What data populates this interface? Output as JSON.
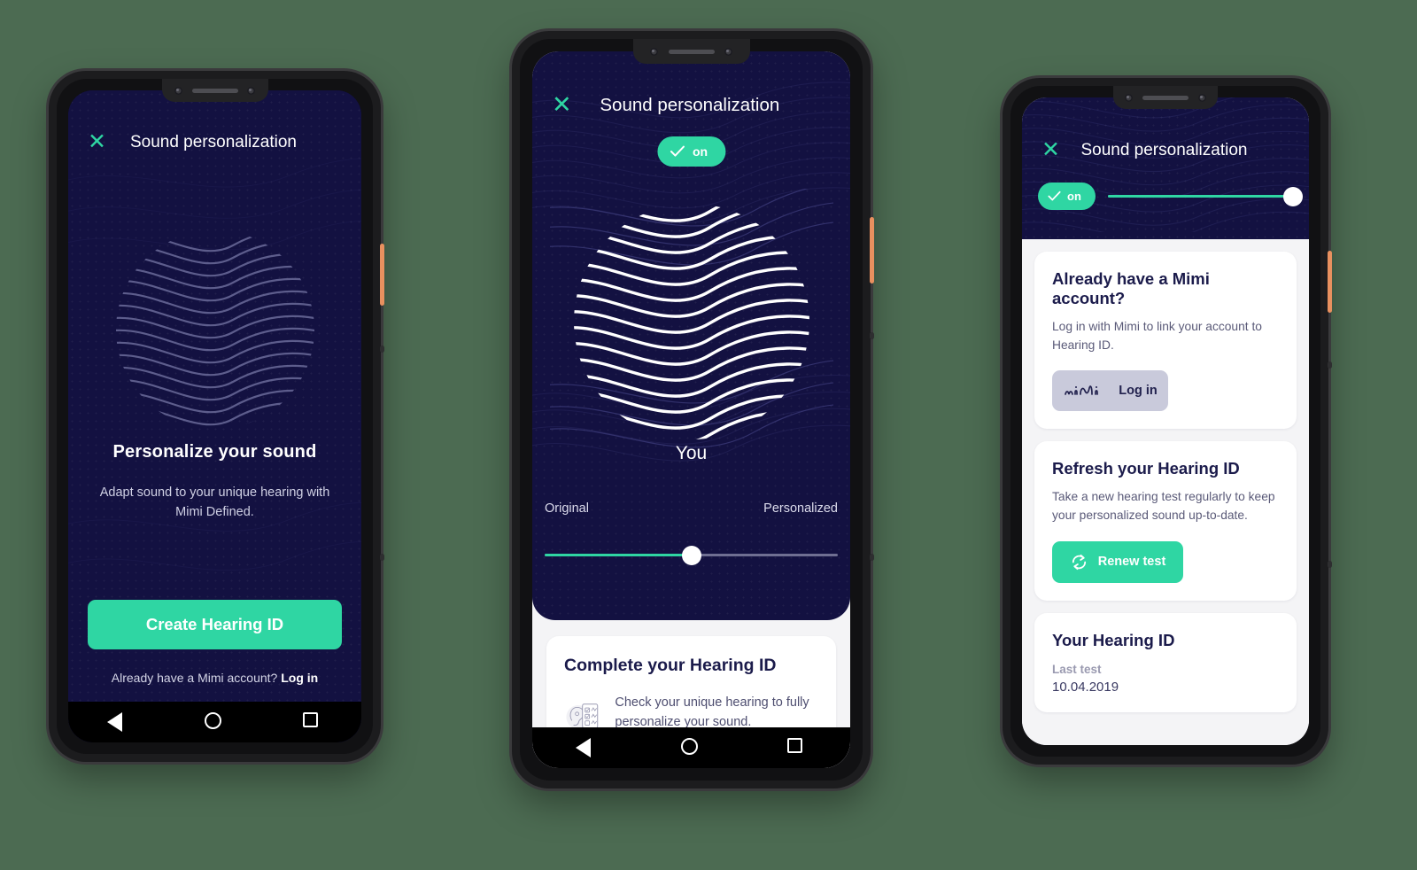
{
  "theme": {
    "page_background": "#4c6b52",
    "navy": "#131141",
    "accent_green": "#2fd6a3",
    "sheet_grey": "#f4f4f6",
    "card_white": "#ffffff",
    "login_button_grey": "#c9cadb",
    "heading_navy": "#1b1b4b"
  },
  "screens": [
    {
      "id": "onboarding",
      "topbar": {
        "close_icon": "close-icon",
        "title": "Sound personalization"
      },
      "hero_icon": "fingerprint-icon",
      "headline": "Personalize your sound",
      "subtext": "Adapt sound to your unique hearing with Mimi Defined.",
      "cta_label": "Create Hearing ID",
      "login_prompt": "Already have a Mimi account? ",
      "login_link": "Log in",
      "navbar": {
        "back_icon": "back-triangle-icon",
        "home_icon": "home-circle-icon",
        "recents_icon": "recents-square-icon"
      }
    },
    {
      "id": "personalization-active",
      "topbar": {
        "close_icon": "close-icon",
        "title": "Sound personalization"
      },
      "toggle": {
        "icon": "check-icon",
        "label": "on",
        "state": "on"
      },
      "hero_icon": "fingerprint-icon",
      "hero_caption": "You",
      "slider": {
        "left_label": "Original",
        "right_label": "Personalized",
        "value_percent": 50
      },
      "card": {
        "title": "Complete your Hearing ID",
        "icon": "ear-checklist-icon",
        "body": "Check your unique hearing to fully personalize your sound."
      },
      "navbar": {
        "back_icon": "back-triangle-icon",
        "home_icon": "home-circle-icon",
        "recents_icon": "recents-square-icon"
      }
    },
    {
      "id": "settings-list",
      "topbar": {
        "close_icon": "close-icon",
        "title": "Sound personalization"
      },
      "toggle": {
        "icon": "check-icon",
        "label": "on",
        "state": "on"
      },
      "slider": {
        "value_percent": 100
      },
      "cards": [
        {
          "title": "Already have a Mimi account?",
          "body": "Log in with Mimi to link your account to Hearing ID.",
          "button": {
            "brand_logo": "mimi-logo",
            "brand_text": "miMi",
            "label": "Log in"
          }
        },
        {
          "title": "Refresh your Hearing ID",
          "body": "Take a new hearing test regularly to keep your personalized sound up-to-date.",
          "button": {
            "icon": "refresh-icon",
            "label": "Renew test"
          }
        },
        {
          "title": "Your Hearing ID",
          "meta_label": "Last test",
          "meta_value": "10.04.2019"
        }
      ]
    }
  ]
}
